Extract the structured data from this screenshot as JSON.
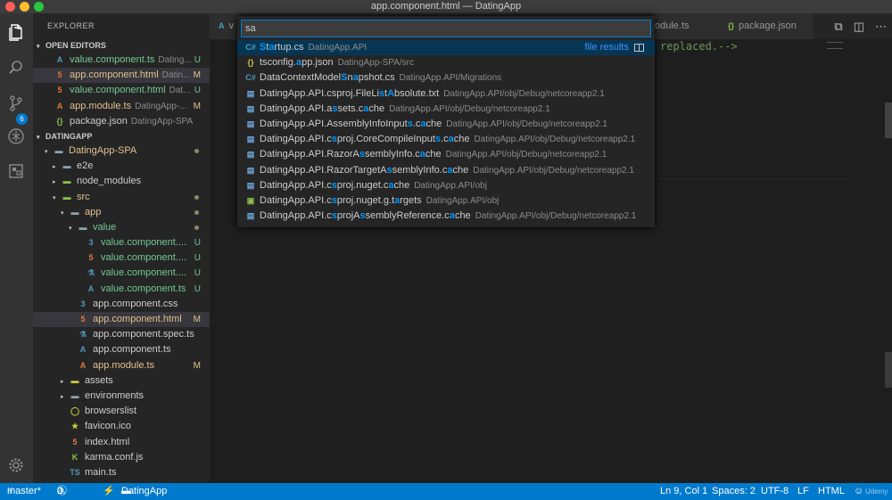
{
  "window": {
    "title": "app.component.html — DatingApp"
  },
  "activity": {
    "scm_badge": "6"
  },
  "sidebar": {
    "title": "EXPLORER",
    "open_editors_label": "OPEN EDITORS",
    "open_editors": [
      {
        "icon": "angular-icon",
        "glyph": "A",
        "name": "value.component.ts",
        "desc": "Dating...",
        "status": "U",
        "name_color": "new"
      },
      {
        "icon": "html-icon",
        "glyph": "5",
        "name": "app.component.html",
        "desc": "Datin...",
        "status": "M",
        "name_color": "mod",
        "selected": true
      },
      {
        "icon": "html-icon",
        "glyph": "5",
        "name": "value.component.html",
        "desc": "Dat...",
        "status": "U",
        "name_color": "new"
      },
      {
        "icon": "angular-red-icon",
        "glyph": "A",
        "name": "app.module.ts",
        "desc": "DatingApp-...",
        "status": "M",
        "name_color": "mod"
      },
      {
        "icon": "json-icon",
        "glyph": "{}",
        "name": "package.json",
        "desc": "DatingApp-SPA",
        "status": "",
        "name_color": "plain"
      }
    ],
    "project_label": "DATINGAPP",
    "tree": [
      {
        "indent": 1,
        "caret": "▾",
        "icon": "folder-icon",
        "glyph": "▬",
        "name": "DatingApp-SPA",
        "status": "dot",
        "name_color": "mod"
      },
      {
        "indent": 2,
        "caret": "▸",
        "icon": "folder-icon",
        "glyph": "▬",
        "name": "e2e",
        "status": "",
        "name_color": "plain"
      },
      {
        "indent": 2,
        "caret": "▸",
        "icon": "folder-node-icon",
        "glyph": "▬",
        "name": "node_modules",
        "status": "",
        "name_color": "plain"
      },
      {
        "indent": 2,
        "caret": "▾",
        "icon": "folder-src-icon",
        "glyph": "▬",
        "name": "src",
        "status": "dot",
        "name_color": "mod"
      },
      {
        "indent": 3,
        "caret": "▾",
        "icon": "folder-app-icon",
        "glyph": "▬",
        "name": "app",
        "status": "dot",
        "name_color": "mod"
      },
      {
        "indent": 4,
        "caret": "▾",
        "icon": "folder-icon",
        "glyph": "▬",
        "name": "value",
        "status": "dot",
        "name_color": "new"
      },
      {
        "indent": 5,
        "caret": "",
        "icon": "css-icon",
        "glyph": "3",
        "name": "value.component....",
        "status": "U",
        "name_color": "new"
      },
      {
        "indent": 5,
        "caret": "",
        "icon": "html-icon",
        "glyph": "5",
        "name": "value.component....",
        "status": "U",
        "name_color": "new"
      },
      {
        "indent": 5,
        "caret": "",
        "icon": "test-icon",
        "glyph": "⚗",
        "name": "value.component....",
        "status": "U",
        "name_color": "new"
      },
      {
        "indent": 5,
        "caret": "",
        "icon": "angular-icon",
        "glyph": "A",
        "name": "value.component.ts",
        "status": "U",
        "name_color": "new"
      },
      {
        "indent": 4,
        "caret": "",
        "icon": "css-icon",
        "glyph": "3",
        "name": "app.component.css",
        "status": "",
        "name_color": "plain"
      },
      {
        "indent": 4,
        "caret": "",
        "icon": "html-icon",
        "glyph": "5",
        "name": "app.component.html",
        "status": "M",
        "name_color": "mod",
        "selected": true
      },
      {
        "indent": 4,
        "caret": "",
        "icon": "test-icon",
        "glyph": "⚗",
        "name": "app.component.spec.ts",
        "status": "",
        "name_color": "plain"
      },
      {
        "indent": 4,
        "caret": "",
        "icon": "angular-icon",
        "glyph": "A",
        "name": "app.component.ts",
        "status": "",
        "name_color": "plain"
      },
      {
        "indent": 4,
        "caret": "",
        "icon": "angular-red-icon",
        "glyph": "A",
        "name": "app.module.ts",
        "status": "M",
        "name_color": "mod"
      },
      {
        "indent": 3,
        "caret": "▸",
        "icon": "folder-assets-icon",
        "glyph": "▬",
        "name": "assets",
        "status": "",
        "name_color": "plain"
      },
      {
        "indent": 3,
        "caret": "▸",
        "icon": "folder-icon",
        "glyph": "▬",
        "name": "environments",
        "status": "",
        "name_color": "plain"
      },
      {
        "indent": 3,
        "caret": "",
        "icon": "browserslist-icon",
        "glyph": "◯",
        "name": "browserslist",
        "status": "",
        "name_color": "plain"
      },
      {
        "indent": 3,
        "caret": "",
        "icon": "star-icon",
        "glyph": "★",
        "name": "favicon.ico",
        "status": "",
        "name_color": "plain"
      },
      {
        "indent": 3,
        "caret": "",
        "icon": "html-icon",
        "glyph": "5",
        "name": "index.html",
        "status": "",
        "name_color": "plain"
      },
      {
        "indent": 3,
        "caret": "",
        "icon": "karma-icon",
        "glyph": "K",
        "name": "karma.conf.js",
        "status": "",
        "name_color": "plain"
      },
      {
        "indent": 3,
        "caret": "",
        "icon": "ts-icon",
        "glyph": "TS",
        "name": "main.ts",
        "status": "",
        "name_color": "plain"
      }
    ]
  },
  "tabs": [
    {
      "label": "v",
      "icon": "angular-icon",
      "glyph": "A"
    },
    {
      "label": "odule.ts",
      "icon": "",
      "glyph": ""
    },
    {
      "label": "package.json",
      "icon": "json-icon",
      "glyph": "{}"
    }
  ],
  "editor": {
    "visible_code": "replaced.-->"
  },
  "quickopen": {
    "query": "sa",
    "file_results_label": "file results",
    "items": [
      {
        "icon": "csharp-icon",
        "glyph": "C#",
        "icls": "ic-cs",
        "parts": [
          [
            "S",
            "h"
          ],
          [
            "t",
            "n"
          ],
          [
            "a",
            "h"
          ],
          [
            "rtup.cs",
            "n"
          ]
        ],
        "desc": "DatingApp.API",
        "focus": true
      },
      {
        "icon": "json-icon",
        "glyph": "{}",
        "icls": "ic-brace",
        "parts": [
          [
            "ts",
            "n"
          ],
          [
            "c",
            "n"
          ],
          [
            "onfig.",
            "n"
          ],
          [
            "a",
            "h"
          ],
          [
            "pp.json",
            "n"
          ]
        ],
        "desc": "DatingApp-SPA/src"
      },
      {
        "icon": "csharp-icon",
        "glyph": "C#",
        "icls": "ic-cs",
        "parts": [
          [
            "DataContextModel",
            "n"
          ],
          [
            "S",
            "h"
          ],
          [
            "n",
            "n"
          ],
          [
            "a",
            "h"
          ],
          [
            "pshot.cs",
            "n"
          ]
        ],
        "desc": "DatingApp.API/Migrations"
      },
      {
        "icon": "document-icon",
        "glyph": "▤",
        "icls": "ic-doc",
        "parts": [
          [
            "DatingApp.API.csproj.FileLi",
            "n"
          ],
          [
            "s",
            "h"
          ],
          [
            "t",
            "n"
          ],
          [
            "A",
            "h"
          ],
          [
            "bsolute.txt",
            "n"
          ]
        ],
        "desc": "DatingApp.API/obj/Debug/netcoreapp2.1"
      },
      {
        "icon": "document-icon",
        "glyph": "▤",
        "icls": "ic-doc",
        "parts": [
          [
            "DatingApp.API.a",
            "n"
          ],
          [
            "s",
            "h"
          ],
          [
            "sets.c",
            "n"
          ],
          [
            "a",
            "h"
          ],
          [
            "che",
            "n"
          ]
        ],
        "desc": "DatingApp.API/obj/Debug/netcoreapp2.1"
      },
      {
        "icon": "document-icon",
        "glyph": "▤",
        "icls": "ic-doc",
        "parts": [
          [
            "DatingApp.API.AssemblyInfoInput",
            "n"
          ],
          [
            "s",
            "h"
          ],
          [
            ".c",
            "n"
          ],
          [
            "a",
            "h"
          ],
          [
            "che",
            "n"
          ]
        ],
        "desc": "DatingApp.API/obj/Debug/netcoreapp2.1"
      },
      {
        "icon": "document-icon",
        "glyph": "▤",
        "icls": "ic-doc",
        "parts": [
          [
            "DatingApp.API.c",
            "n"
          ],
          [
            "s",
            "h"
          ],
          [
            "proj.CoreCompileInput",
            "n"
          ],
          [
            "s",
            "h"
          ],
          [
            ".c",
            "n"
          ],
          [
            "a",
            "h"
          ],
          [
            "che",
            "n"
          ]
        ],
        "desc": "DatingApp.API/obj/Debug/netcoreapp2.1"
      },
      {
        "icon": "document-icon",
        "glyph": "▤",
        "icls": "ic-doc",
        "parts": [
          [
            "DatingApp.API.RazorA",
            "n"
          ],
          [
            "s",
            "h"
          ],
          [
            "semblyInfo.c",
            "n"
          ],
          [
            "a",
            "h"
          ],
          [
            "che",
            "n"
          ]
        ],
        "desc": "DatingApp.API/obj/Debug/netcoreapp2.1"
      },
      {
        "icon": "document-icon",
        "glyph": "▤",
        "icls": "ic-doc",
        "parts": [
          [
            "DatingApp.API.RazorTargetA",
            "n"
          ],
          [
            "s",
            "h"
          ],
          [
            "semblyInfo.c",
            "n"
          ],
          [
            "a",
            "h"
          ],
          [
            "che",
            "n"
          ]
        ],
        "desc": "DatingApp.API/obj/Debug/netcoreapp2.1"
      },
      {
        "icon": "document-icon",
        "glyph": "▤",
        "icls": "ic-doc",
        "parts": [
          [
            "DatingApp.API.c",
            "n"
          ],
          [
            "s",
            "h"
          ],
          [
            "proj.nuget.c",
            "n"
          ],
          [
            "a",
            "h"
          ],
          [
            "che",
            "n"
          ]
        ],
        "desc": "DatingApp.API/obj"
      },
      {
        "icon": "msbuild-icon",
        "glyph": "▣",
        "icls": "ic-green",
        "parts": [
          [
            "DatingApp.API.c",
            "n"
          ],
          [
            "s",
            "h"
          ],
          [
            "proj.nuget.g.t",
            "n"
          ],
          [
            "a",
            "h"
          ],
          [
            "rgets",
            "n"
          ]
        ],
        "desc": "DatingApp.API/obj"
      },
      {
        "icon": "document-icon",
        "glyph": "▤",
        "icls": "ic-doc",
        "parts": [
          [
            "DatingApp.API.c",
            "n"
          ],
          [
            "s",
            "h"
          ],
          [
            "projA",
            "n"
          ],
          [
            "s",
            "h"
          ],
          [
            "semblyReference.c",
            "n"
          ],
          [
            "a",
            "h"
          ],
          [
            "che",
            "n"
          ]
        ],
        "desc": "DatingApp.API/obj/Debug/netcoreapp2.1"
      }
    ]
  },
  "statusbar": {
    "branch": "master*",
    "errors": "0",
    "warnings": "0",
    "folder": "DatingApp",
    "position": "Ln 9, Col 1",
    "spaces": "Spaces: 2",
    "encoding": "UTF-8",
    "eol": "LF",
    "language": "HTML",
    "watermark": "Udemy"
  },
  "colors": {
    "accent": "#007acc",
    "modified": "#e2c08d",
    "untracked": "#73c991",
    "match_highlight": "#0097fb"
  }
}
